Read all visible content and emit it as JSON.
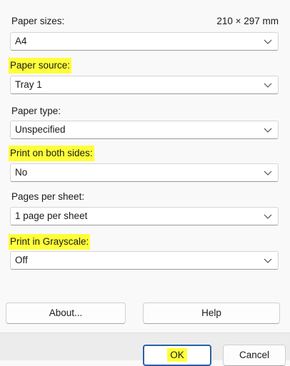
{
  "paper_sizes": {
    "label": "Paper sizes:",
    "dimensions": "210 × 297 mm",
    "value": "A4"
  },
  "paper_source": {
    "label": "Paper source:",
    "value": "Tray 1"
  },
  "paper_type": {
    "label": "Paper type:",
    "value": "Unspecified"
  },
  "print_both_sides": {
    "label": "Print on both sides:",
    "value": "No"
  },
  "pages_per_sheet": {
    "label": "Pages per sheet:",
    "value": "1 page per sheet"
  },
  "print_grayscale": {
    "label": "Print in Grayscale:",
    "value": "Off"
  },
  "buttons": {
    "about": "About...",
    "help": "Help",
    "ok": "OK",
    "cancel": "Cancel"
  },
  "colors": {
    "highlight": "#ffff3a",
    "ok_border": "#2a5fa8"
  },
  "icons": {
    "dropdown": "chevron-down-icon"
  }
}
